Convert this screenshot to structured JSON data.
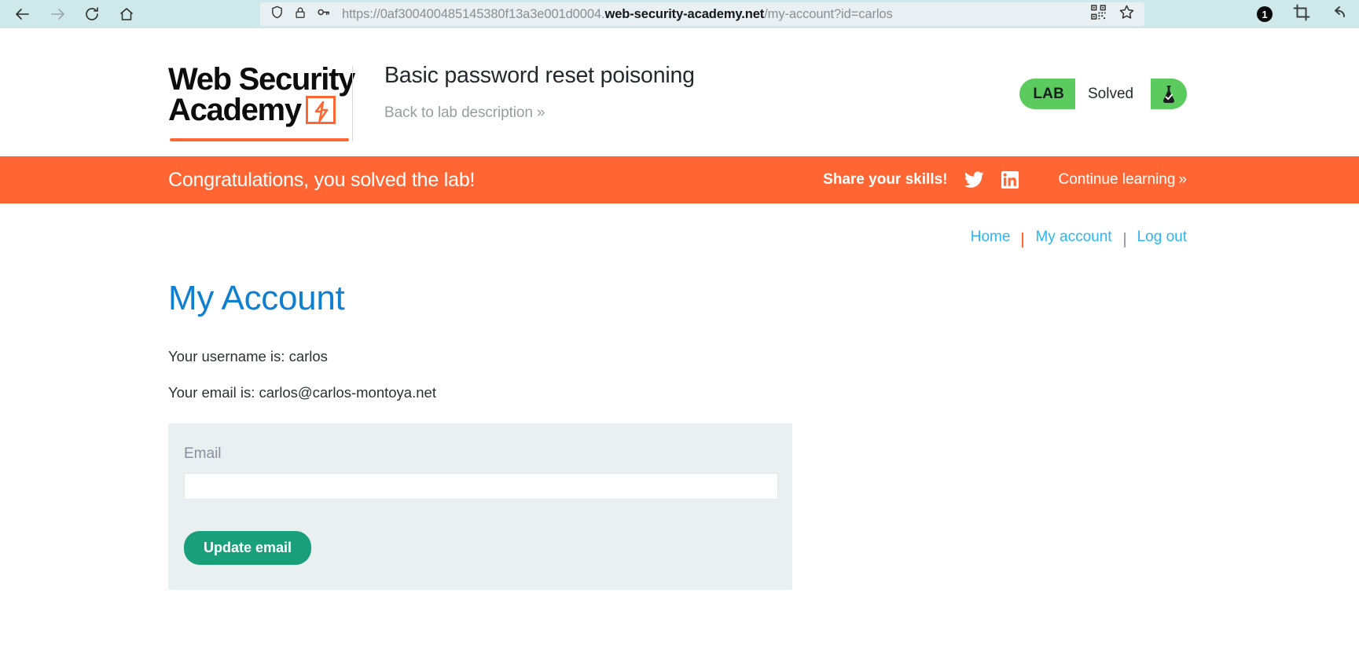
{
  "browser": {
    "back_icon": "back-arrow-icon",
    "forward_icon": "forward-arrow-icon",
    "reload_icon": "reload-icon",
    "home_icon": "home-icon",
    "shield_icon": "shield-icon",
    "lock_icon": "lock-icon",
    "key_icon": "key-icon",
    "url_scheme": "https://0af300400485145380f13a3e001d0004.",
    "url_host": "web-security-academy.net",
    "url_path": "/my-account?id=carlos",
    "url_full": "https://0af300400485145380f13a3e001d0004.web-security-academy.net/my-account?id=carlos",
    "qr_icon": "qr-code-icon",
    "bookmark_icon": "star-bookmark-icon",
    "notification_count": "1",
    "crop_icon": "crop-icon",
    "undo_icon": "undo-arrow-icon",
    "toolbar_bg": "#cfe9ea",
    "urlbar_bg": "#e9f0f3"
  },
  "header": {
    "logo_line1": "Web Security",
    "logo_line2": "Academy",
    "logo_bolt_icon": "lightning-bolt-icon",
    "lab_title": "Basic password reset poisoning",
    "back_to_lab": "Back to lab description",
    "back_chevron": "»",
    "lab_status": {
      "tag": "LAB",
      "state": "Solved",
      "flask_icon": "flask-check-icon",
      "color": "#5ccb5f"
    }
  },
  "banner": {
    "message": "Congratulations, you solved the lab!",
    "share_label": "Share your skills!",
    "twitter_icon": "twitter-icon",
    "linkedin_icon": "linkedin-icon",
    "continue_label": "Continue learning",
    "continue_chevron": "»",
    "background": "#ff6633"
  },
  "account_nav": {
    "home": "Home",
    "my_account": "My account",
    "log_out": "Log out",
    "link_color": "#29b6f6"
  },
  "main": {
    "title": "My Account",
    "title_color": "#0f7fcf",
    "username_line": "Your username is: carlos",
    "email_line": "Your email is: carlos@carlos-montoya.net",
    "form": {
      "email_label": "Email",
      "email_value": "",
      "email_placeholder": "",
      "submit_label": "Update email",
      "submit_color": "#19a07a",
      "card_background": "#eaeff2"
    }
  }
}
